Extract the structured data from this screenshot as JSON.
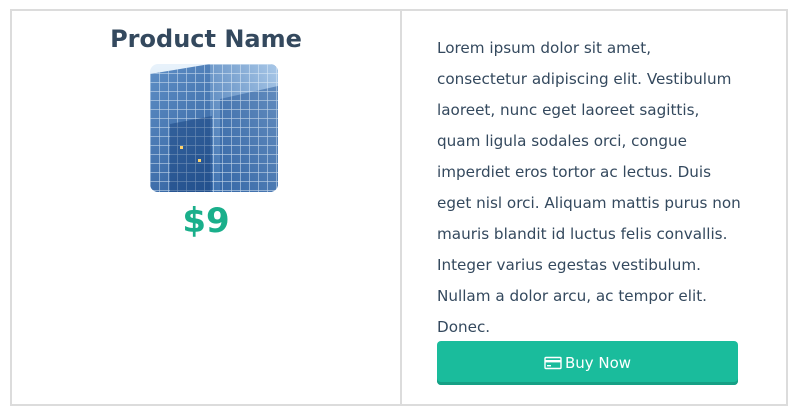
{
  "product": {
    "name": "Product Name",
    "price": "$9",
    "image_icon": "office-building-glass-facade"
  },
  "description": "Lorem ipsum dolor sit amet, consectetur adipiscing elit. Vestibulum laoreet, nunc eget laoreet sagittis, quam ligula sodales orci, congue imperdiet eros tortor ac lectus. Duis eget nisl orci. Aliquam mattis purus non mauris blandit id luctus felis convallis. Integer varius egestas vestibulum. Nullam a dolor arcu, ac tempor elit. Donec.",
  "buy_button": {
    "label": "Buy Now",
    "icon": "credit-card-icon"
  },
  "colors": {
    "title": "#34495e",
    "price": "#1aaf8b",
    "button_bg": "#1abc9c",
    "border": "#dcdcdc"
  }
}
